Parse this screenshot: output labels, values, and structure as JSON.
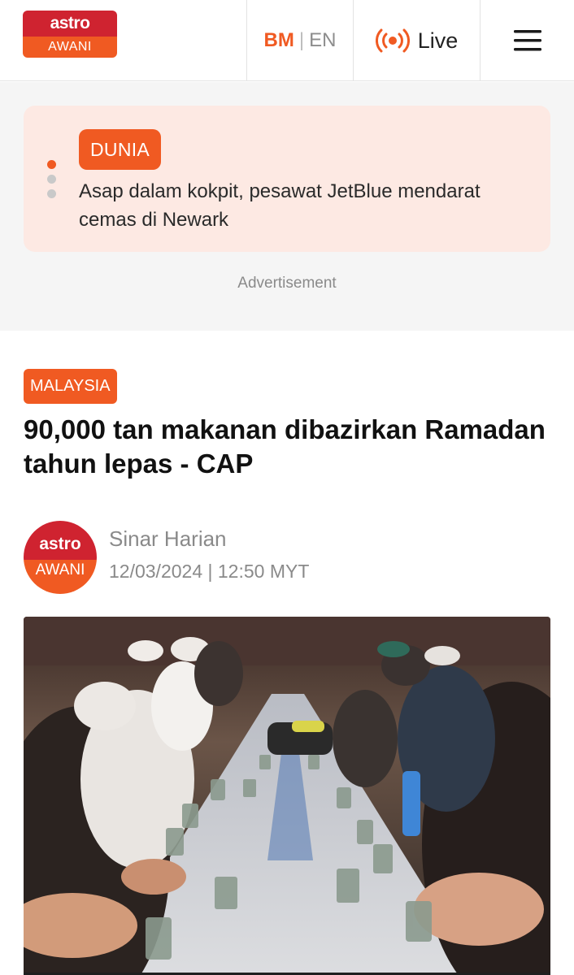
{
  "header": {
    "logo_top": "astro",
    "logo_bottom": "AWANI",
    "lang_bm": "BM",
    "lang_sep": "|",
    "lang_en": "EN",
    "live_label": "Live"
  },
  "ticker": {
    "category": "DUNIA",
    "headline": "Asap dalam kokpit, pesawat JetBlue mendarat cemas di Newark",
    "active_dot": 1,
    "dot_count": 3
  },
  "ad_label": "Advertisement",
  "article": {
    "category": "MALAYSIA",
    "title": "90,000 tan makanan dibazirkan Ramadan tahun lepas - CAP",
    "author": "Sinar Harian",
    "date": "12/03/2024",
    "time_sep": "|",
    "time": "12:50 MYT",
    "avatar_top": "astro",
    "avatar_bottom": "AWANI"
  },
  "colors": {
    "accent": "#f05a22",
    "brand_red": "#cf2330",
    "ticker_bg": "#fde9e3"
  }
}
